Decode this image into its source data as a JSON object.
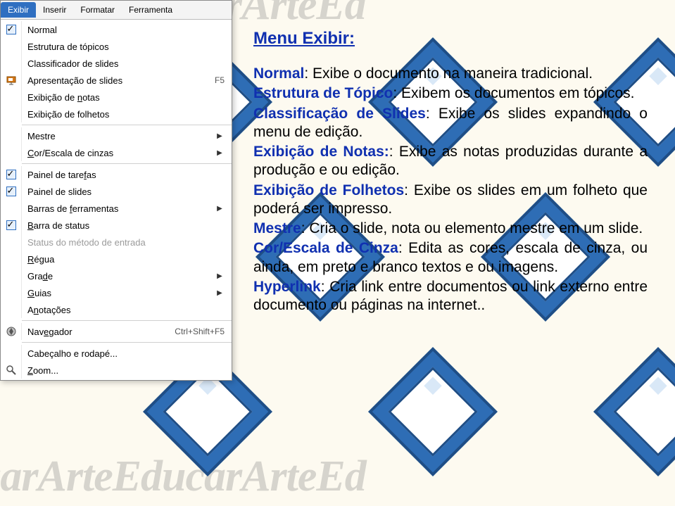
{
  "menubar": {
    "exibir": "Exibir",
    "inserir": "Inserir",
    "formatar": "Formatar",
    "ferramenta": "Ferramenta"
  },
  "menu": {
    "normal": "Normal",
    "estrutura_topicos": "Estrutura de tópicos",
    "classificador_slides": "Classificador de slides",
    "apresentacao_slides": "Apresentação de slides",
    "apresentacao_slides_accel": "F5",
    "exibicao_notas_pre": "Exibição de ",
    "exibicao_notas_u": "n",
    "exibicao_notas_post": "otas",
    "exibicao_folhetos": "Exibição de folhetos",
    "mestre": "Mestre",
    "cor_escala_u": "C",
    "cor_escala_post": "or/Escala de cinzas",
    "painel_tarefas_pre": "Painel de tare",
    "painel_tarefas_u": "f",
    "painel_tarefas_post": "as",
    "painel_slides": "Painel de slides",
    "barras_ferr_pre": "Barras de ",
    "barras_ferr_u": "f",
    "barras_ferr_post": "erramentas",
    "barra_status_u": "B",
    "barra_status_post": "arra de status",
    "status_metodo": "Status do método de entrada",
    "regua_u": "R",
    "regua_post": "égua",
    "grade_pre": "Gra",
    "grade_u": "d",
    "grade_post": "e",
    "guias_u": "G",
    "guias_post": "uias",
    "anotacoes_pre": "A",
    "anotacoes_u": "n",
    "anotacoes_post": "otações",
    "navegador_pre": "Nav",
    "navegador_u": "e",
    "navegador_post": "gador",
    "navegador_accel": "Ctrl+Shift+F5",
    "cabecalho_rodape": "Cabeçalho e rodapé...",
    "zoom_u": "Z",
    "zoom_post": "oom..."
  },
  "content": {
    "title": "Menu Exibir:",
    "normal_t": "Normal",
    "normal_d": ": Exibe o documento na maneira tradicional.",
    "estrutura_t": "Estrutura de Tópico",
    "estrutura_d": ": Exibem os documentos em tópicos.",
    "class_t": "Classificação de Slides",
    "class_d": ": Exibe os slides expandindo o menu de edição.",
    "notas_t": "Exibição de Notas:",
    "notas_d": ": Exibe as notas produzidas durante a produção e ou edição.",
    "folhetos_t": "Exibição de Folhetos",
    "folhetos_d": ": Exibe os slides em um folheto que poderá ser impresso.",
    "mestre_t": "Mestre",
    "mestre_d": ": Cria o slide, nota ou elemento mestre em um slide.",
    "cor_t": "Cor/Escala de Cinza",
    "cor_d": ": Edita as cores, escala de cinza, ou ainda, em preto e branco textos e ou imagens.",
    "hyper_t": "Hyperlink",
    "hyper_d": ": Cria link entre documentos ou link externo entre documento ou páginas na internet.."
  },
  "watermark": "EducarArteEducarArteEd"
}
